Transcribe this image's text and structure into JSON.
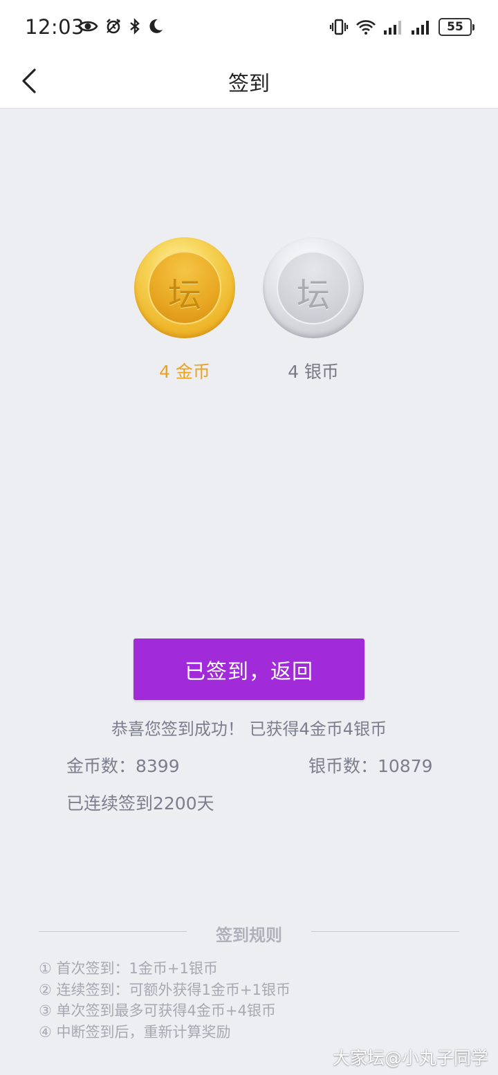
{
  "status_bar": {
    "time": "12:03",
    "battery": "55",
    "left_icons": [
      "eye-icon",
      "alarm-icon",
      "bluetooth-icon",
      "moon-icon"
    ],
    "right_icons": [
      "vibrate-icon",
      "wifi-icon",
      "signal-icon",
      "signal-icon"
    ]
  },
  "nav": {
    "title": "签到"
  },
  "coins": {
    "gold": {
      "glyph": "坛",
      "label": "4 金币",
      "color": "#eba21c"
    },
    "silver": {
      "glyph": "坛",
      "label": "4 银币",
      "color": "#777a85"
    }
  },
  "action_button": {
    "label": "已签到，返回",
    "color": "#a12ad9"
  },
  "result": {
    "message": "恭喜您签到成功！ 已获得4金币4银币",
    "gold_count": "金币数：8399",
    "silver_count": "银币数：10879",
    "streak": "已连续签到2200天"
  },
  "rules": {
    "title": "签到规则",
    "items": [
      "① 首次签到：1金币+1银币",
      "② 连续签到：可额外获得1金币+1银币",
      "③ 单次签到最多可获得4金币+4银币",
      "④ 中断签到后，重新计算奖励"
    ]
  },
  "watermark": "大家坛@小丸子同学"
}
